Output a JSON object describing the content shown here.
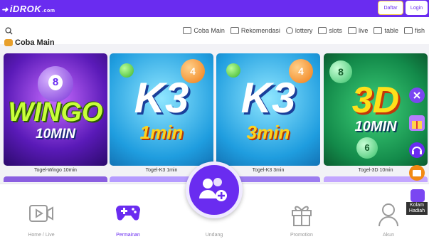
{
  "header": {
    "logo": "iDROK",
    "logo_suffix": ".com",
    "daftar_label": "Daftar",
    "login_label": "Login"
  },
  "categories": [
    {
      "label": "Coba Main",
      "icon": "gamepad-icon"
    },
    {
      "label": "Rekomendasi",
      "icon": "thumbs-up-icon"
    },
    {
      "label": "lottery",
      "icon": "lottery-icon"
    },
    {
      "label": "slots",
      "icon": "slots-icon"
    },
    {
      "label": "live",
      "icon": "live-icon"
    },
    {
      "label": "table",
      "icon": "table-icon"
    },
    {
      "label": "fish",
      "icon": "fish-icon"
    }
  ],
  "section": {
    "title": "Coba Main"
  },
  "games": [
    {
      "label": "Togel-Wingo 10min",
      "line1": "WINGO",
      "line2": "10MIN"
    },
    {
      "label": "Togel-K3 1min",
      "line1": "K3",
      "line2": "1min"
    },
    {
      "label": "Togel-K3 3min",
      "line1": "K3",
      "line2": "3min"
    },
    {
      "label": "Togel-3D 10min",
      "line1": "3D",
      "line2": "10MIN"
    }
  ],
  "ball_numbers": {
    "wingo": "8",
    "k3_1": "4",
    "k3_2": "4",
    "d3_a": "8",
    "d3_b": "6"
  },
  "nav": [
    {
      "label": "Home / Live",
      "icon": "video-icon"
    },
    {
      "label": "Permainan",
      "icon": "gamepad-icon"
    },
    {
      "label": "Undang",
      "icon": "users-add-icon"
    },
    {
      "label": "Promotion",
      "icon": "gift-icon"
    },
    {
      "label": "Akun",
      "icon": "user-icon"
    }
  ],
  "floating": {
    "kolam_label": "Kolam Hadiah"
  },
  "colors": {
    "brand": "#6a2cf0",
    "muted": "#999999"
  }
}
